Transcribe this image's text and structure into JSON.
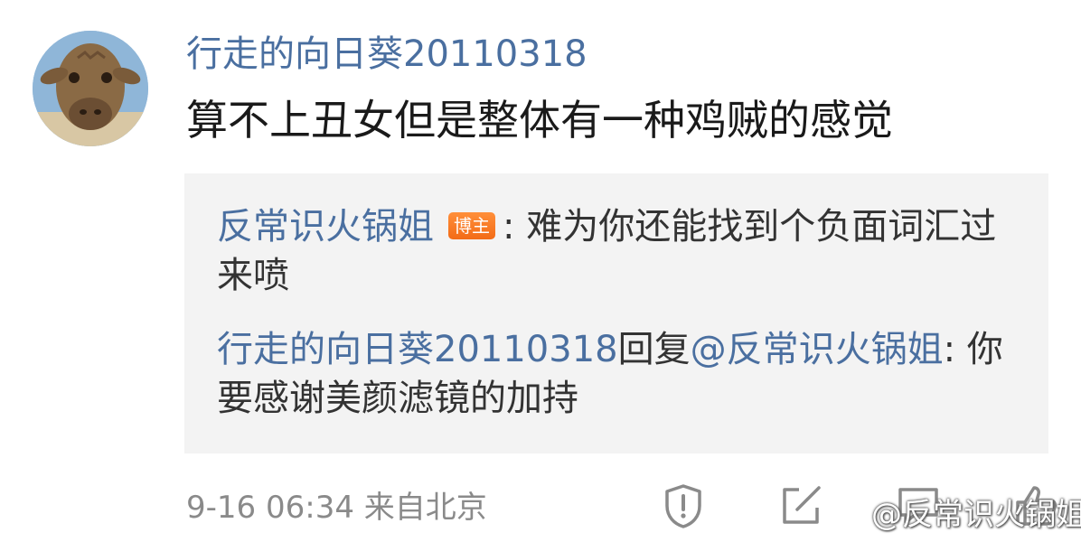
{
  "comment": {
    "username": "行走的向日葵20110318",
    "text": "算不上丑女但是整体有一种鸡贼的感觉",
    "avatar_icon": "giraffe-avatar"
  },
  "replies": [
    {
      "author": "反常识火锅姐",
      "badge": "博主",
      "separator": ": ",
      "text": "难为你还能找到个负面词汇过来喷"
    },
    {
      "author": "行走的向日葵20110318",
      "reply_word": "回复",
      "mention": "@反常识火锅姐",
      "separator": ": ",
      "text": "你要感谢美颜滤镜的加持"
    }
  ],
  "meta": {
    "time": "9-16 06:34",
    "location": "来自北京"
  },
  "actions": {
    "icons": [
      "report-icon",
      "share-icon",
      "comment-icon",
      "like-icon"
    ]
  },
  "watermark": {
    "text": "@反常识火锅姐",
    "icon": "weibo-logo-icon"
  },
  "colors": {
    "link": "#4a6fa0",
    "badge": "#f36b16",
    "reply_bg": "#f3f3f3",
    "meta": "#8a8a8a"
  }
}
